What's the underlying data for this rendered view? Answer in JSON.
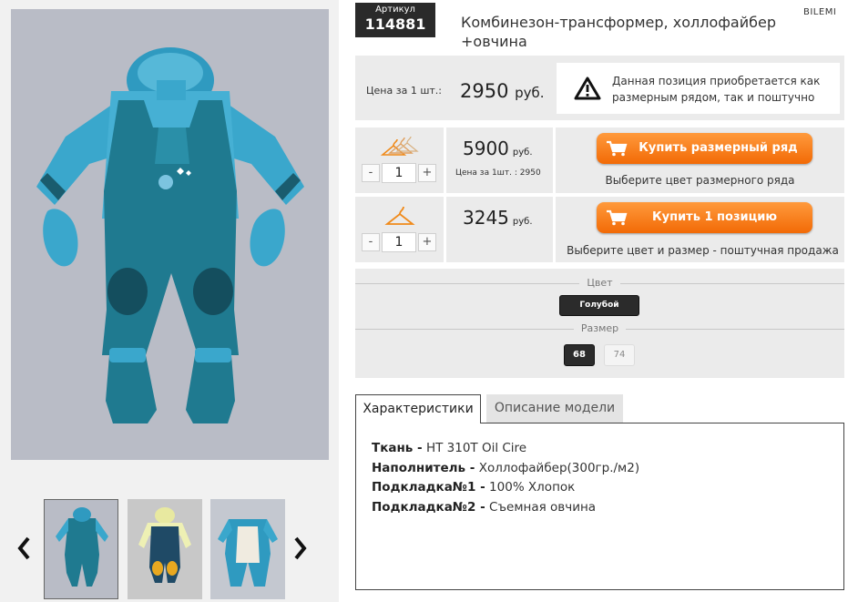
{
  "product": {
    "article_label": "Артикул",
    "article_number": "114881",
    "title": "Комбинезон-трансформер, холлофайбер +овчина",
    "brand": "BILEMI"
  },
  "price": {
    "label": "Цена за 1 шт.:",
    "value": "2950",
    "currency": "руб.",
    "notice": "Данная позиция приобретается как размерным рядом, так и поштучно",
    "notice_icon": "warning-icon"
  },
  "purchase_rows": [
    {
      "icon": "hangers-set-icon",
      "qty": "1",
      "minus": "-",
      "plus": "+",
      "amount": "5900",
      "currency": "руб.",
      "sub": "Цена за 1шт. : 2950",
      "button": "Купить размерный ряд",
      "hint": "Выберите цвет размерного ряда"
    },
    {
      "icon": "hanger-icon",
      "qty": "1",
      "minus": "-",
      "plus": "+",
      "amount": "3245",
      "currency": "руб.",
      "button": "Купить 1 позицию",
      "hint": "Выберите цвет и размер - поштучная продажа"
    }
  ],
  "options": {
    "color_header": "Цвет",
    "color_value": "Голубой",
    "size_header": "Размер",
    "sizes": [
      "68",
      "74"
    ],
    "selected_size": "68"
  },
  "tabs": [
    {
      "label": "Характеристики",
      "active": true
    },
    {
      "label": "Описание модели",
      "active": false
    }
  ],
  "specs": [
    {
      "key": "Ткань -",
      "value": "HT 310T Oil Cire"
    },
    {
      "key": "Наполнитель -",
      "value": "Холлофайбер(300гр./м2)"
    },
    {
      "key": "Подкладка№1 -",
      "value": "100% Хлопок"
    },
    {
      "key": "Подкладка№2 -",
      "value": "Съемная овчина"
    }
  ],
  "gallery": {
    "prev_icon": "chevron-left-icon",
    "next_icon": "chevron-right-icon",
    "thumbnail_count": 3,
    "selected_thumbnail": 1
  },
  "colors": {
    "accent_orange": "#f57a14",
    "dark_chip": "#2b2b2b",
    "panel_bg": "#ebebeb",
    "suit_teal": "#1f7a90",
    "suit_light": "#3aa7cc"
  }
}
